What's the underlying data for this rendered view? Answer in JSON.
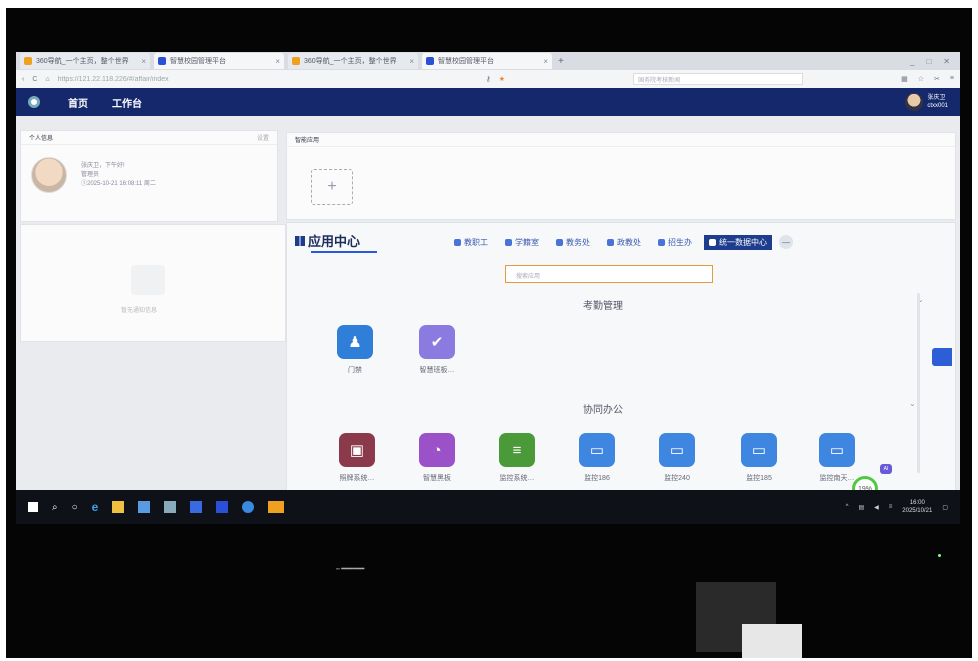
{
  "browser": {
    "tabs": [
      {
        "label": "360导航_一个主页，整个世界",
        "active": false
      },
      {
        "label": "智慧校园管理平台",
        "active": true
      },
      {
        "label": "360导航_一个主页，整个世界",
        "active": false
      },
      {
        "label": "智慧校园管理平台",
        "active": true
      }
    ],
    "new_tab": "+",
    "url": "https://121.22.118.226/#/affair/index",
    "search_placeholder": "国务院考核新闻",
    "win_controls": [
      "_",
      "□",
      "✕"
    ]
  },
  "header": {
    "nav": [
      "首页",
      "工作台"
    ],
    "user_name": "张庆卫",
    "user_id": "ctxx001"
  },
  "personal_card": {
    "title": "个人信息",
    "more": "设置",
    "greeting": "张庆卫，下午好!",
    "role": "管理员",
    "login_time": "①2025-10-21 16:08:11 周二"
  },
  "empty_card": {
    "text": "暂无通知信息"
  },
  "smart_card": {
    "title": "智能应用",
    "add": "+"
  },
  "app_center": {
    "title": "应用中心",
    "categories": [
      {
        "label": "教职工",
        "active": false
      },
      {
        "label": "学籍室",
        "active": false
      },
      {
        "label": "教务处",
        "active": false
      },
      {
        "label": "政教处",
        "active": false
      },
      {
        "label": "招生办",
        "active": false
      },
      {
        "label": "统一数据中心",
        "active": true
      }
    ],
    "more": "—",
    "search_placeholder": "搜索应用",
    "section1": "考勤管理",
    "section2": "协同办公",
    "apps_row1": [
      {
        "label": "门禁",
        "color": "#2f7fd8",
        "icon": "person-icon"
      },
      {
        "label": "智慧班板…",
        "color": "#8b7ae0",
        "icon": "check-icon"
      }
    ],
    "apps_row2": [
      {
        "label": "照牌系统…",
        "color": "#8a3a4a",
        "icon": "image-icon"
      },
      {
        "label": "智慧黑板",
        "color": "#9b52c8",
        "icon": "pie-icon"
      },
      {
        "label": "监控系统…",
        "color": "#4a9a3a",
        "icon": "database-icon"
      },
      {
        "label": "监控186",
        "color": "#3f86e0",
        "icon": "monitor-icon"
      },
      {
        "label": "监控240",
        "color": "#3f86e0",
        "icon": "monitor-icon"
      },
      {
        "label": "监控185",
        "color": "#3f86e0",
        "icon": "monitor-icon"
      },
      {
        "label": "监控南天…",
        "color": "#3f86e0",
        "icon": "monitor-icon"
      }
    ]
  },
  "floating": {
    "ai": "AI",
    "percent": "19%"
  },
  "taskbar": {
    "time": "16:00",
    "date": "2025/10/21"
  }
}
